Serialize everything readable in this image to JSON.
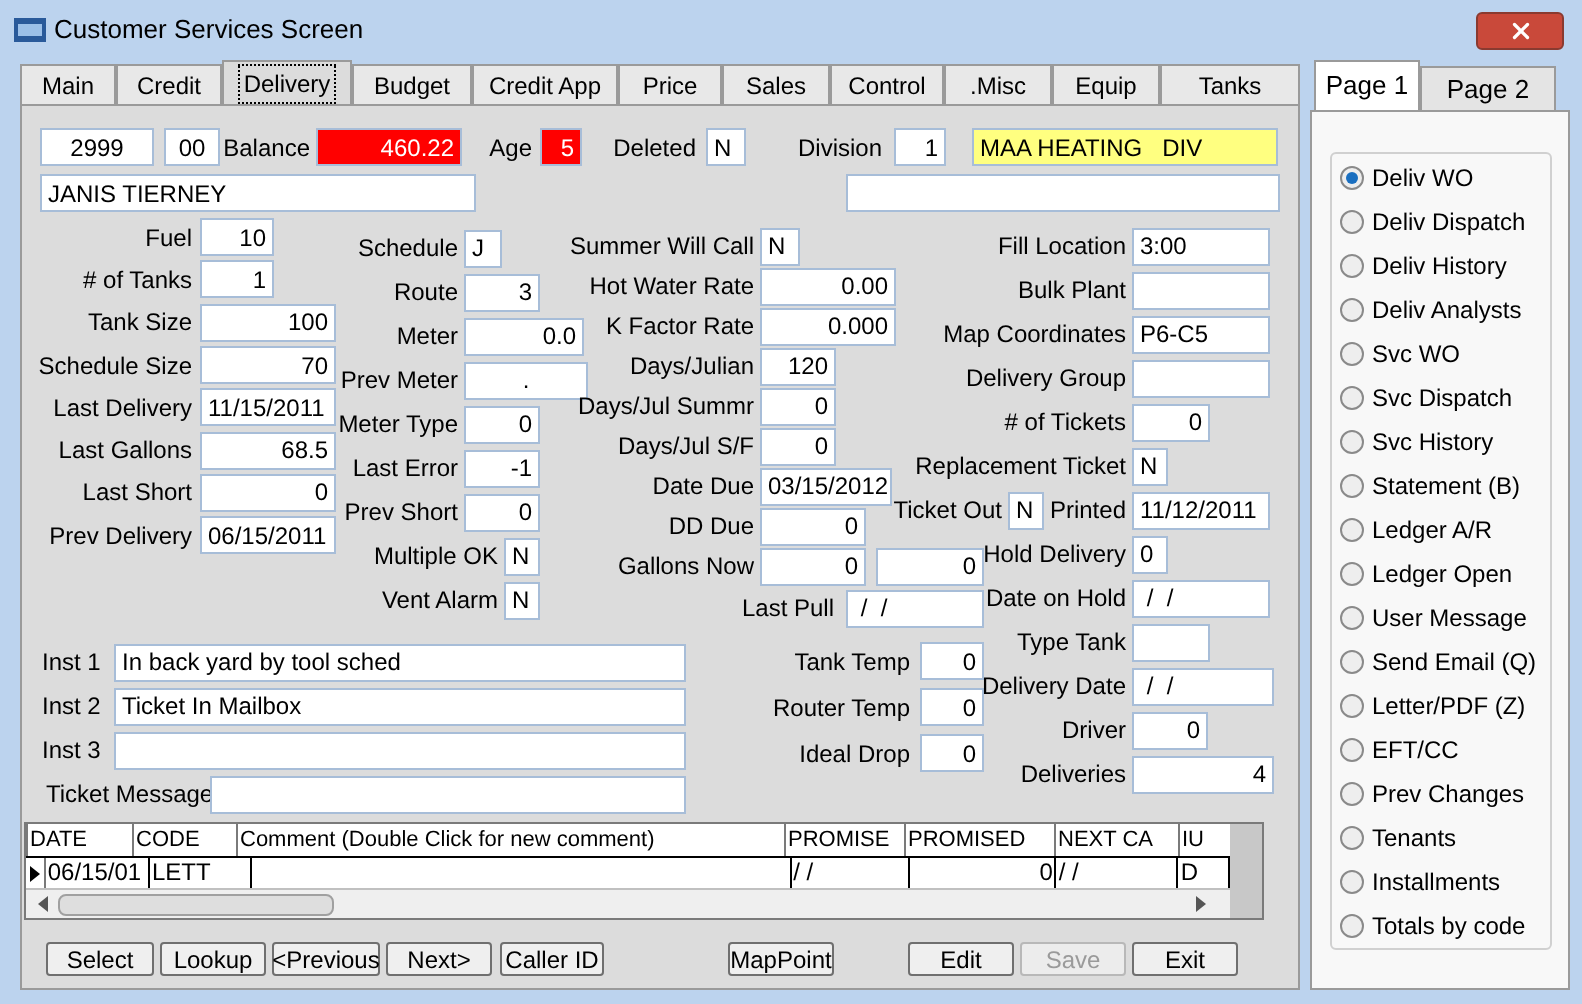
{
  "window": {
    "title": "Customer Services Screen"
  },
  "tabs": [
    {
      "label": "Main",
      "selected": false
    },
    {
      "label": "Credit",
      "selected": false
    },
    {
      "label": "Delivery",
      "selected": true
    },
    {
      "label": "Budget",
      "selected": false
    },
    {
      "label": "Credit App",
      "selected": false
    },
    {
      "label": "Price",
      "selected": false
    },
    {
      "label": "Sales",
      "selected": false
    },
    {
      "label": "Control",
      "selected": false
    },
    {
      "label": ".Misc",
      "selected": false
    },
    {
      "label": "Equip",
      "selected": false
    },
    {
      "label": "Tanks",
      "selected": false
    }
  ],
  "header": {
    "account": "2999",
    "sub_account": "00",
    "balance": {
      "label": "Balance",
      "value": "460.22",
      "color": "#ff0000"
    },
    "age": {
      "label": "Age",
      "value": "5",
      "color": "#ff0000"
    },
    "deleted": {
      "label": "Deleted",
      "value": "N"
    },
    "division": {
      "label": "Division",
      "value": "1"
    },
    "division_name": {
      "value": "MAA HEATING   DIV",
      "color": "#ffff80"
    },
    "customer_name": "JANIS TIERNEY"
  },
  "column_a": [
    {
      "label": "Fuel",
      "value": "10",
      "kind": "number"
    },
    {
      "label": "# of Tanks",
      "value": "1",
      "kind": "number"
    },
    {
      "label": "Tank Size",
      "value": "100",
      "kind": "number"
    },
    {
      "label": "Schedule Size",
      "value": "70",
      "kind": "number"
    },
    {
      "label": "Last Delivery",
      "value": "11/15/2011",
      "kind": "text"
    },
    {
      "label": "Last Gallons",
      "value": "68.5",
      "kind": "number"
    },
    {
      "label": "Last Short",
      "value": "0",
      "kind": "number"
    },
    {
      "label": "Prev Delivery",
      "value": "06/15/2011",
      "kind": "text"
    }
  ],
  "column_b": [
    {
      "label": "Schedule",
      "value": "J",
      "kind": "text"
    },
    {
      "label": "Route",
      "value": "3",
      "kind": "number"
    },
    {
      "label": "Meter",
      "value": "0.0",
      "kind": "number"
    },
    {
      "label": "Prev Meter",
      "value": ".",
      "kind": "center"
    },
    {
      "label": "Meter Type",
      "value": "0",
      "kind": "number"
    },
    {
      "label": "Last Error",
      "value": "-1",
      "kind": "number"
    },
    {
      "label": "Prev Short",
      "value": "0",
      "kind": "number"
    },
    {
      "label": "Multiple OK",
      "value": "N",
      "kind": "text"
    },
    {
      "label": "Vent Alarm",
      "value": "N",
      "kind": "text"
    }
  ],
  "column_c": [
    {
      "label": "Summer Will Call",
      "value": "N",
      "kind": "text"
    },
    {
      "label": "Hot Water Rate",
      "value": "0.00",
      "kind": "number"
    },
    {
      "label": "K Factor Rate",
      "value": "0.000",
      "kind": "number"
    },
    {
      "label": "Days/Julian",
      "value": "120",
      "kind": "number"
    },
    {
      "label": "Days/Jul Summr",
      "value": "0",
      "kind": "number"
    },
    {
      "label": "Days/Jul S/F",
      "value": "0",
      "kind": "number"
    },
    {
      "label": "Date Due",
      "value": "03/15/2012",
      "kind": "text"
    },
    {
      "label": "DD Due",
      "value": "0",
      "kind": "number"
    },
    {
      "label": "Gallons Now",
      "value": "0",
      "value_2": "0",
      "kind": "number"
    }
  ],
  "last_pull": {
    "label": "Last Pull",
    "value": " /  /"
  },
  "temperatures": [
    {
      "label": "Tank Temp",
      "value": "0"
    },
    {
      "label": "Router Temp",
      "value": "0"
    },
    {
      "label": "Ideal Drop",
      "value": "0"
    }
  ],
  "column_d": [
    {
      "label": "Fill Location",
      "value": "3:00",
      "kind": "text"
    },
    {
      "label": "Bulk Plant",
      "kind": "text"
    },
    {
      "label": "Map Coordinates",
      "value": "P6-C5",
      "kind": "text"
    },
    {
      "label": "Delivery Group",
      "kind": "text"
    },
    {
      "label": "# of Tickets",
      "value": "0",
      "kind": "number"
    },
    {
      "label": "Replacement Ticket",
      "value": "N",
      "kind": "text"
    },
    {
      "label": "Ticket Out",
      "value": "N",
      "kind": "text",
      "second": {
        "label": "Printed",
        "value": "11/12/2011"
      }
    },
    {
      "label": "Hold Delivery",
      "value": "0",
      "kind": "text"
    },
    {
      "label": "Date on Hold",
      "value": " /  /",
      "kind": "text"
    },
    {
      "label": "Type Tank",
      "kind": "text"
    },
    {
      "label": "Delivery Date",
      "value": " /  /",
      "kind": "text"
    },
    {
      "label": "Driver",
      "value": "0",
      "kind": "number"
    },
    {
      "label": "Deliveries",
      "value": "4",
      "kind": "number"
    }
  ],
  "instructions": [
    {
      "label": "Inst 1",
      "value": "In back yard by tool sched"
    },
    {
      "label": "Inst 2",
      "value": "Ticket In Mailbox"
    },
    {
      "label": "Inst 3"
    }
  ],
  "ticket_message": {
    "label": "Ticket Message"
  },
  "table": {
    "columns": [
      "DATE",
      "CODE",
      "Comment (Double Click for new comment)",
      "PROMISE",
      "PROMISED",
      "NEXT CA",
      "IU"
    ],
    "rows": [
      {
        "selected": true,
        "date": "06/15/01",
        "code": "LETT",
        "promise": "/ /",
        "promised": "0",
        "next_ca": "/ /",
        "column_7": "D"
      }
    ]
  },
  "buttons": [
    {
      "label": "Select",
      "disabled": false
    },
    {
      "label": "Lookup",
      "disabled": false
    },
    {
      "label": "<Previous",
      "disabled": false
    },
    {
      "label": "Next>",
      "disabled": false
    },
    {
      "label": "Caller ID",
      "disabled": false
    },
    {
      "label": "MapPoint",
      "disabled": false
    },
    {
      "label": "Edit",
      "disabled": false
    },
    {
      "label": "Save",
      "disabled": true
    },
    {
      "label": "Exit",
      "disabled": false
    }
  ],
  "side_tabs": [
    {
      "label": "Page 1",
      "selected": true
    },
    {
      "label": "Page 2",
      "selected": false
    }
  ],
  "options": [
    {
      "label": "Deliv WO",
      "selected": true
    },
    {
      "label": "Deliv Dispatch",
      "selected": false
    },
    {
      "label": "Deliv History",
      "selected": false
    },
    {
      "label": "Deliv Analysts",
      "selected": false
    },
    {
      "label": "Svc WO",
      "selected": false
    },
    {
      "label": "Svc Dispatch",
      "selected": false
    },
    {
      "label": "Svc History",
      "selected": false
    },
    {
      "label": "Statement (B)",
      "selected": false
    },
    {
      "label": "Ledger A/R",
      "selected": false
    },
    {
      "label": "Ledger Open",
      "selected": false
    },
    {
      "label": "User Message",
      "selected": false
    },
    {
      "label": "Send Email (Q)",
      "selected": false
    },
    {
      "label": "Letter/PDF (Z)",
      "selected": false
    },
    {
      "label": "EFT/CC",
      "selected": false
    },
    {
      "label": "Prev Changes",
      "selected": false
    },
    {
      "label": "Tenants",
      "selected": false
    },
    {
      "label": "Installments",
      "selected": false
    },
    {
      "label": "Totals by code",
      "selected": false
    }
  ]
}
